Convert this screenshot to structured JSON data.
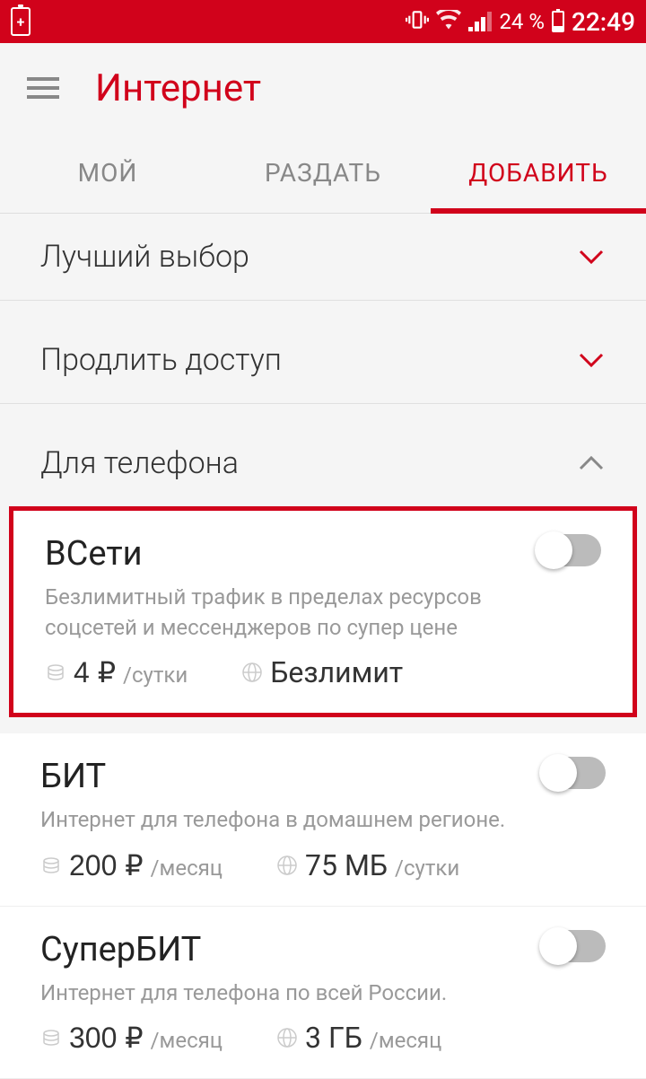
{
  "status": {
    "battery_pct": "24 %",
    "time": "22:49"
  },
  "header": {
    "title": "Интернет"
  },
  "tabs": {
    "items": [
      {
        "label": "МОЙ"
      },
      {
        "label": "РАЗДАТЬ"
      },
      {
        "label": "ДОБАВИТЬ"
      }
    ],
    "active_index": 2
  },
  "sections": [
    {
      "title": "Лучший выбор",
      "expanded": false
    },
    {
      "title": "Продлить доступ",
      "expanded": false
    },
    {
      "title": "Для телефона",
      "expanded": true
    }
  ],
  "options": [
    {
      "name": "ВСети",
      "desc": "Безлимитный трафик в пределах ресурсов соцсетей и мессенджеров по супер цене",
      "price_value": "4 ₽",
      "price_unit": "/сутки",
      "quota_value": "Безлимит",
      "quota_unit": "",
      "highlighted": true,
      "enabled": false
    },
    {
      "name": "БИТ",
      "desc": "Интернет для телефона в домашнем регионе.",
      "price_value": "200 ₽",
      "price_unit": "/месяц",
      "quota_value": "75 МБ",
      "quota_unit": "/сутки",
      "highlighted": false,
      "enabled": false
    },
    {
      "name": "СуперБИТ",
      "desc": "Интернет для телефона по всей России.",
      "price_value": "300 ₽",
      "price_unit": "/месяц",
      "quota_value": "3 ГБ",
      "quota_unit": "/месяц",
      "highlighted": false,
      "enabled": false
    }
  ]
}
